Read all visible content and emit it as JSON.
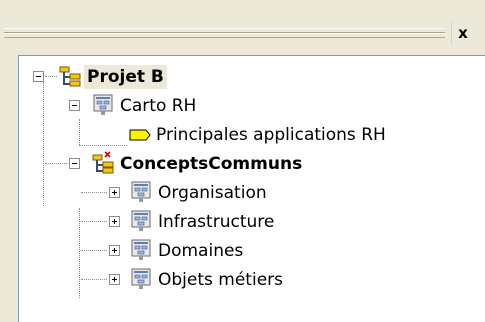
{
  "window": {
    "close_glyph": "x"
  },
  "tree": {
    "items": [
      {
        "label": "Projet B",
        "icon": "project-icon",
        "expander": "minus"
      },
      {
        "label": "Carto RH",
        "icon": "diagram-icon",
        "expander": "minus"
      },
      {
        "label": "Principales applications RH",
        "icon": "yellow-tag-icon",
        "expander": "none"
      },
      {
        "label": "ConceptsCommuns",
        "icon": "project-shared-icon",
        "expander": "minus"
      },
      {
        "label": "Organisation",
        "icon": "diagram-icon",
        "expander": "plus"
      },
      {
        "label": "Infrastructure",
        "icon": "diagram-icon",
        "expander": "plus"
      },
      {
        "label": "Domaines",
        "icon": "diagram-icon",
        "expander": "plus"
      },
      {
        "label": "Objets métiers",
        "icon": "diagram-icon",
        "expander": "plus"
      }
    ]
  }
}
